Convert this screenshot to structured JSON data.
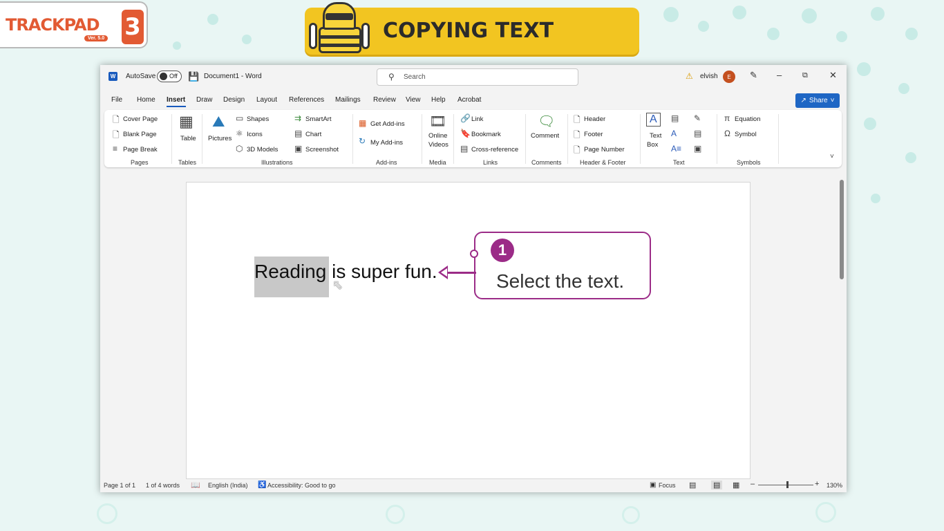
{
  "logo": {
    "text": "TRACKPAD",
    "version": "Ver. 5.0",
    "number": "3"
  },
  "banner": {
    "title": "COPYING TEXT"
  },
  "titlebar": {
    "autosave_label": "AutoSave",
    "autosave_state": "Off",
    "doc_title": "Document1 - Word",
    "search_placeholder": "Search",
    "user_name": "elvish",
    "user_initial": "E"
  },
  "menu": {
    "tabs": [
      "File",
      "Home",
      "Insert",
      "Draw",
      "Design",
      "Layout",
      "References",
      "Mailings",
      "Review",
      "View",
      "Help",
      "Acrobat"
    ],
    "active": "Insert",
    "share_label": "Share"
  },
  "ribbon": {
    "pages": {
      "items": [
        "Cover Page",
        "Blank Page",
        "Page Break"
      ],
      "label": "Pages"
    },
    "tables": {
      "item": "Table",
      "label": "Tables"
    },
    "illustrations": {
      "pictures": "Pictures",
      "shapes": "Shapes",
      "icons": "Icons",
      "models": "3D Models",
      "smartart": "SmartArt",
      "chart": "Chart",
      "screenshot": "Screenshot",
      "label": "Illustrations"
    },
    "addins": {
      "get": "Get Add-ins",
      "my": "My Add-ins",
      "label": "Add-ins"
    },
    "media": {
      "online_videos_1": "Online",
      "online_videos_2": "Videos",
      "label": "Media"
    },
    "links": {
      "link": "Link",
      "bookmark": "Bookmark",
      "cross_reference": "Cross-reference",
      "label": "Links"
    },
    "comments": {
      "comment": "Comment",
      "label": "Comments"
    },
    "header_footer": {
      "header": "Header",
      "footer": "Footer",
      "page_number": "Page Number",
      "label": "Header & Footer"
    },
    "text": {
      "text_box_1": "Text",
      "text_box_2": "Box",
      "label": "Text"
    },
    "symbols": {
      "equation": "Equation",
      "symbol": "Symbol",
      "label": "Symbols"
    }
  },
  "document": {
    "selected_text": "Reading",
    "rest_text": " is super fun."
  },
  "statusbar": {
    "page": "Page 1 of 1",
    "words": "1 of 4 words",
    "language": "English (India)",
    "accessibility": "Accessibility: Good to go",
    "focus": "Focus",
    "zoom": "130%"
  },
  "callout": {
    "number": "1",
    "text": "Select the text."
  },
  "colors": {
    "accent": "#9b2b87",
    "banner": "#f2c521",
    "brand": "#e25a33",
    "share": "#1e66c4"
  }
}
